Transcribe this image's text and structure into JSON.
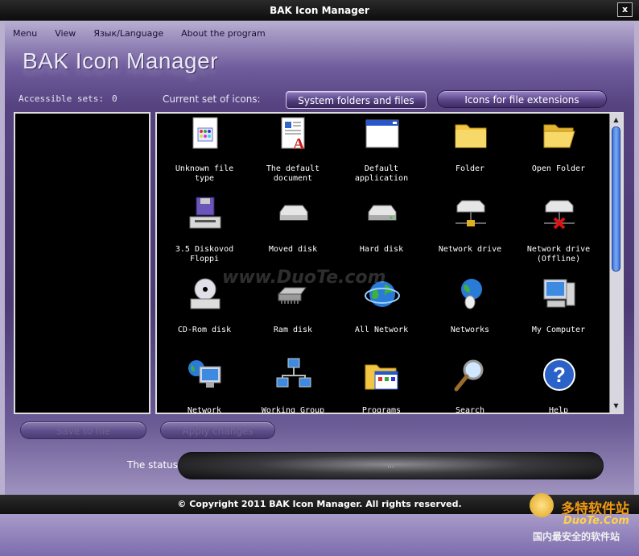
{
  "window": {
    "title": "BAK Icon Manager",
    "close_label": "x"
  },
  "menu": {
    "items": [
      "Menu",
      "View",
      "Язык/Language",
      "About the program"
    ]
  },
  "logo": "BAK Icon Manager",
  "sets": {
    "label": "Accessible sets:",
    "count": "0"
  },
  "current_set": {
    "label": "Current set of icons:",
    "tabs": [
      "System folders and files",
      "Icons for file extensions"
    ],
    "active_tab": "System folders and files"
  },
  "icons": [
    {
      "caption": "Unknown file\ntype",
      "icon": "unknown-file-icon"
    },
    {
      "caption": "The default\ndocument",
      "icon": "document-icon"
    },
    {
      "caption": "Default\napplication",
      "icon": "application-window-icon"
    },
    {
      "caption": "Folder",
      "icon": "folder-icon"
    },
    {
      "caption": "Open Folder",
      "icon": "open-folder-icon"
    },
    {
      "caption": "3.5 Diskovod\nFloppi",
      "icon": "floppy-drive-icon"
    },
    {
      "caption": "Moved disk",
      "icon": "removable-disk-icon"
    },
    {
      "caption": "Hard disk",
      "icon": "hard-disk-icon"
    },
    {
      "caption": "Network drive",
      "icon": "network-drive-icon"
    },
    {
      "caption": "Network drive\n(Offline)",
      "icon": "network-drive-offline-icon"
    },
    {
      "caption": "CD-Rom disk",
      "icon": "cdrom-icon"
    },
    {
      "caption": "Ram disk",
      "icon": "ram-disk-icon"
    },
    {
      "caption": "All Network",
      "icon": "globe-network-icon"
    },
    {
      "caption": "Networks",
      "icon": "networks-icon"
    },
    {
      "caption": "My Computer",
      "icon": "my-computer-icon"
    },
    {
      "caption": "Network",
      "icon": "network-computer-icon"
    },
    {
      "caption": "Working Group",
      "icon": "workgroup-icon"
    },
    {
      "caption": "Programs",
      "icon": "programs-folder-icon"
    },
    {
      "caption": "Search",
      "icon": "search-icon"
    },
    {
      "caption": "Help",
      "icon": "help-icon"
    }
  ],
  "actions": {
    "save": "Save to file",
    "apply": "Apply changes"
  },
  "status": {
    "label": "The status",
    "value": "..."
  },
  "footer": "© Copyright 2011 BAK Icon Manager. All rights reserved.",
  "watermark": {
    "text": "www.DuoTe.com",
    "brand_cn": "多特软件站",
    "brand_url": "DuoTe.Com",
    "slogan": "国内最安全的软件站"
  },
  "colors": {
    "panel_bg": "#000000",
    "frame_purple": "#4b3a73",
    "scroll_thumb": "#3a6fd8"
  }
}
